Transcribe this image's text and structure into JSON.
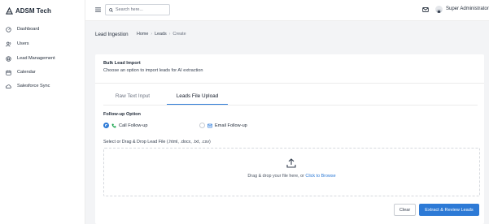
{
  "brand": {
    "name": "ADSM Tech"
  },
  "sidebar": {
    "items": [
      {
        "label": "Dashboard",
        "icon": "dashboard-icon"
      },
      {
        "label": "Users",
        "icon": "users-icon"
      },
      {
        "label": "Lead Management",
        "icon": "target-icon"
      },
      {
        "label": "Calendar",
        "icon": "calendar-icon"
      },
      {
        "label": "Salesforce Sync",
        "icon": "cloud-sync-icon"
      }
    ]
  },
  "topbar": {
    "search_placeholder": "Search here...",
    "user_name": "Super Administrator"
  },
  "page": {
    "title": "Lead Ingestion",
    "breadcrumb": [
      "Home",
      "Leads",
      "Create"
    ]
  },
  "card": {
    "title": "Bulk Lead Import",
    "subtitle": "Choose an option to import leads for AI extraction",
    "tabs": [
      {
        "label": "Raw Text Input",
        "active": false
      },
      {
        "label": "Leads File Upload",
        "active": true
      }
    ],
    "followup": {
      "label": "Follow-up Option",
      "options": [
        {
          "label": "Call Follow-up",
          "selected": true,
          "icon": "phone-icon"
        },
        {
          "label": "Email Follow-up",
          "selected": false,
          "icon": "mail-icon"
        }
      ]
    },
    "dropzone": {
      "label": "Select or Drag & Drop Lead File (.html, .docx, .txt, .csv)",
      "text": "Drag & drop your file here, or ",
      "link": "Click to Browse"
    },
    "buttons": {
      "clear": "Clear",
      "submit": "Extract & Review Leads"
    }
  },
  "colors": {
    "accent": "#2d7ad6",
    "background": "#f3f4f6",
    "phone_icon": "#16a34a"
  }
}
